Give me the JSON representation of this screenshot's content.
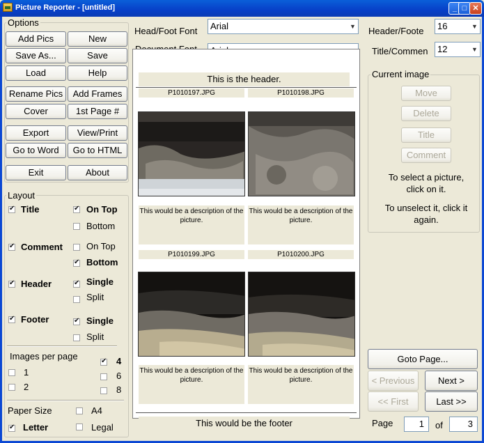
{
  "window": {
    "title": "Picture Reporter - [untitled]"
  },
  "options": {
    "label": "Options",
    "buttons": [
      "Add Pics",
      "New",
      "Save As...",
      "Save",
      "Load",
      "Help",
      "Rename Pics",
      "Add Frames",
      "Cover",
      "1st Page #",
      "Export",
      "View/Print",
      "Go to Word",
      "Go to HTML",
      "Exit",
      "About"
    ]
  },
  "layout": {
    "label": "Layout",
    "title": {
      "label": "Title",
      "checked": true,
      "on_top": "On Top",
      "on_top_checked": true,
      "bottom": "Bottom",
      "bottom_checked": false
    },
    "comment": {
      "label": "Comment",
      "checked": true,
      "on_top": "On Top",
      "on_top_checked": false,
      "bottom": "Bottom",
      "bottom_checked": true
    },
    "header": {
      "label": "Header",
      "checked": true,
      "single": "Single",
      "single_checked": true,
      "split": "Split",
      "split_checked": false
    },
    "footer": {
      "label": "Footer",
      "checked": true,
      "single": "Single",
      "single_checked": true,
      "split": "Split",
      "split_checked": false
    },
    "images_per_page": {
      "label": "Images per page",
      "options": [
        "1",
        "2",
        "4",
        "6",
        "8"
      ],
      "selected": "4"
    },
    "paper_size": {
      "label": "Paper Size",
      "options": [
        "A4",
        "Letter",
        "Legal"
      ],
      "selected": "Letter"
    }
  },
  "fonts": {
    "head_foot_label": "Head/Foot Font",
    "head_foot_value": "Arial",
    "document_label": "Document Font",
    "document_value": "Arial",
    "header_footer_size_label": "Header/Foote",
    "header_footer_size": "16",
    "title_comment_size_label": "Title/Commen",
    "title_comment_size": "12"
  },
  "preview": {
    "header": "This is the header.",
    "footer": "This would be the footer",
    "pictures": [
      {
        "filename": "P1010197.JPG",
        "description": "This would be a description of the picture."
      },
      {
        "filename": "P1010198.JPG",
        "description": "This would be a description of the picture."
      },
      {
        "filename": "P1010199.JPG",
        "description": "This would be a description of the picture."
      },
      {
        "filename": "P1010200.JPG",
        "description": "This would be a description of the picture."
      }
    ]
  },
  "current_image": {
    "label": "Current image",
    "buttons": [
      "Move",
      "Delete",
      "Title",
      "Comment"
    ],
    "select_hint": "To select a picture, click on it.",
    "unselect_hint": "To unselect it, click it again."
  },
  "navigation": {
    "goto": "Goto Page...",
    "previous": "< Previous",
    "next": "Next >",
    "first": "<< First",
    "last": "Last >>",
    "page_label": "Page",
    "page": "1",
    "of_label": "of",
    "total": "3"
  }
}
